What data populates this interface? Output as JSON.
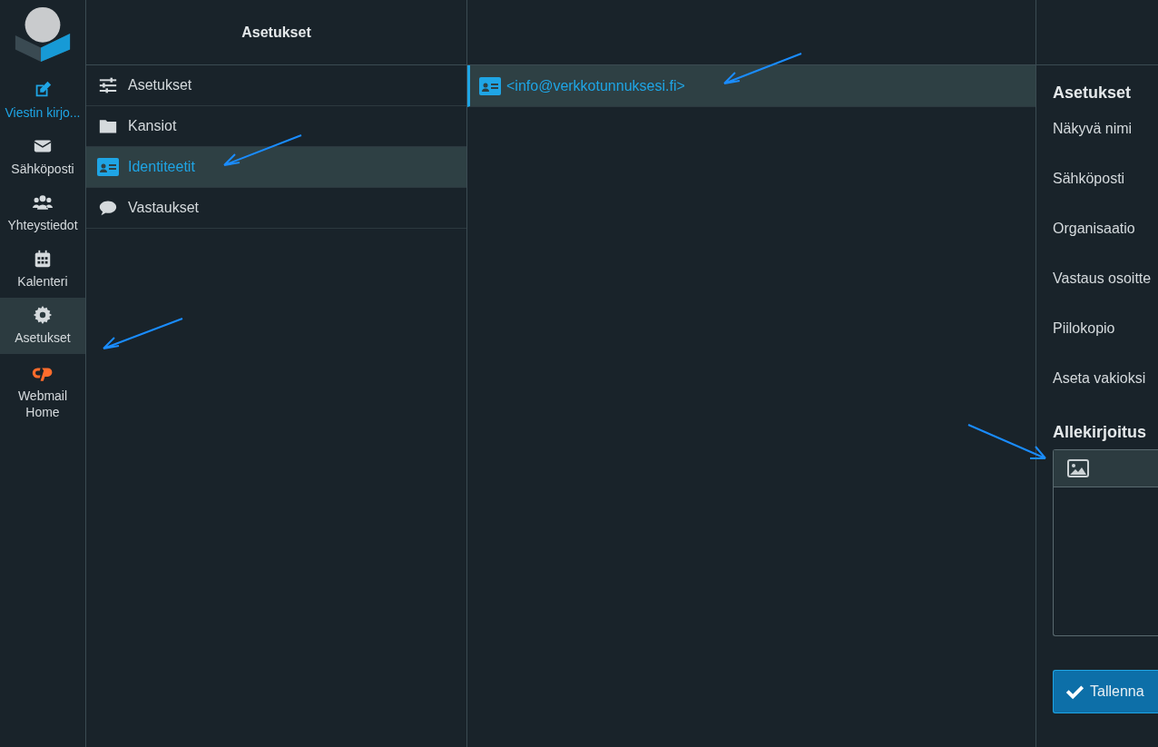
{
  "nav": [
    {
      "label": "Viestin kirjo...",
      "kind": "action",
      "selected": false
    },
    {
      "label": "Sähköposti",
      "kind": "link",
      "selected": false
    },
    {
      "label": "Yhteystiedot",
      "kind": "link",
      "selected": false
    },
    {
      "label": "Kalenteri",
      "kind": "link",
      "selected": false
    },
    {
      "label": "Asetukset",
      "kind": "link",
      "selected": true
    },
    {
      "label": "Webmail Home",
      "kind": "brand",
      "selected": false
    }
  ],
  "settings": {
    "title": "Asetukset",
    "items": [
      {
        "label": "Asetukset",
        "selected": false
      },
      {
        "label": "Kansiot",
        "selected": false
      },
      {
        "label": "Identiteetit",
        "selected": true
      },
      {
        "label": "Vastaukset",
        "selected": false
      }
    ]
  },
  "identities": [
    {
      "label": "<info@verkkotunnuksesi.fi>",
      "selected": true
    }
  ],
  "form": {
    "section": "Asetukset",
    "fields": [
      "Näkyvä nimi",
      "Sähköposti",
      "Organisaatio",
      "Vastaus osoitte",
      "Piilokopio",
      "Aseta vakioksi"
    ],
    "signature_title": "Allekirjoitus",
    "save": "Tallenna"
  }
}
